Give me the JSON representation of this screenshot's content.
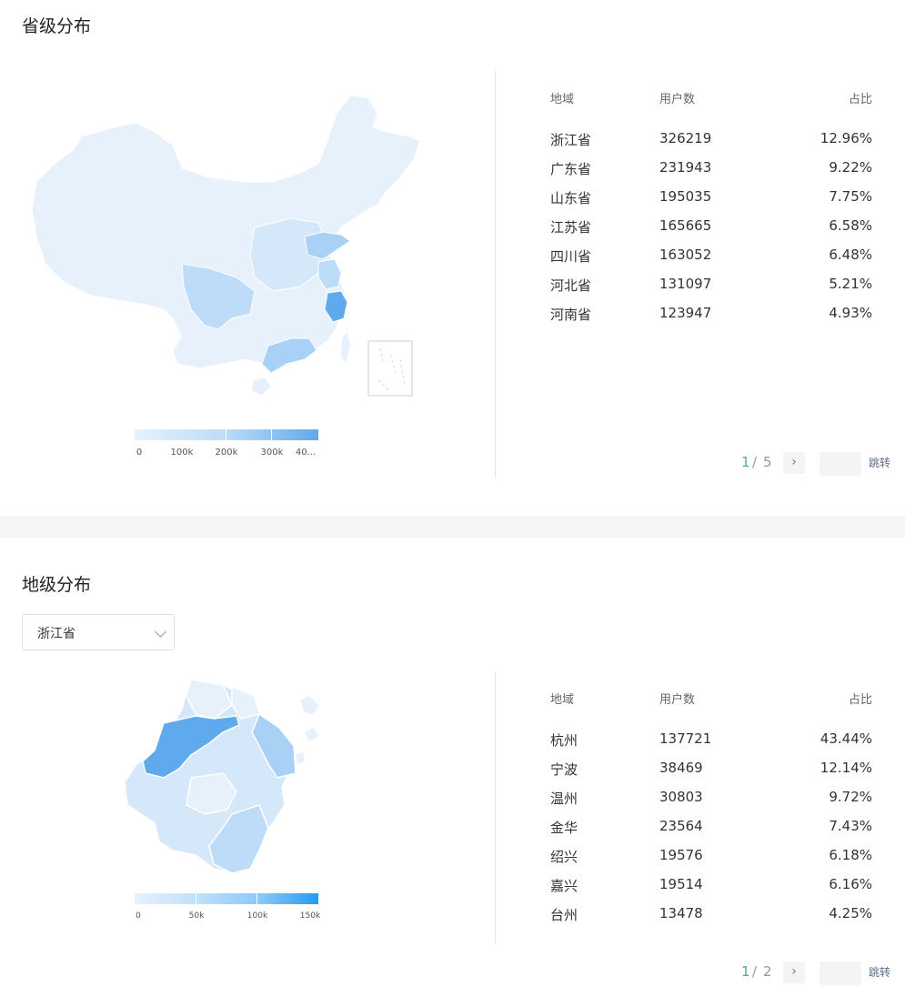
{
  "province_section": {
    "title": "省级分布",
    "legend": {
      "labels": [
        "0",
        "100k",
        "200k",
        "300k",
        "40..."
      ]
    },
    "table": {
      "headers": [
        "地域",
        "用户数",
        "占比"
      ],
      "rows": [
        [
          "浙江省",
          "326219",
          "12.96%"
        ],
        [
          "广东省",
          "231943",
          "9.22%"
        ],
        [
          "山东省",
          "195035",
          "7.75%"
        ],
        [
          "江苏省",
          "165665",
          "6.58%"
        ],
        [
          "四川省",
          "163052",
          "6.48%"
        ],
        [
          "河北省",
          "131097",
          "5.21%"
        ],
        [
          "河南省",
          "123947",
          "4.93%"
        ]
      ]
    },
    "pager": {
      "current": "1",
      "sep": "/",
      "total": "5",
      "next": "›",
      "jump": "跳转"
    }
  },
  "city_section": {
    "title": "地级分布",
    "select": {
      "value": "浙江省"
    },
    "legend": {
      "labels": [
        "0",
        "50k",
        "100k",
        "150k"
      ]
    },
    "table": {
      "headers": [
        "地域",
        "用户数",
        "占比"
      ],
      "rows": [
        [
          "杭州",
          "137721",
          "43.44%"
        ],
        [
          "宁波",
          "38469",
          "12.14%"
        ],
        [
          "温州",
          "30803",
          "9.72%"
        ],
        [
          "金华",
          "23564",
          "7.43%"
        ],
        [
          "绍兴",
          "19576",
          "6.18%"
        ],
        [
          "嘉兴",
          "19514",
          "6.16%"
        ],
        [
          "台州",
          "13478",
          "4.25%"
        ]
      ]
    },
    "pager": {
      "current": "1",
      "sep": "/",
      "total": "2",
      "next": "›",
      "jump": "跳转"
    }
  },
  "colors": {
    "light": "#e6f1fc",
    "mid": "#bcdcf7",
    "strong": "#5eaaec",
    "accent": "#4caf7a"
  }
}
